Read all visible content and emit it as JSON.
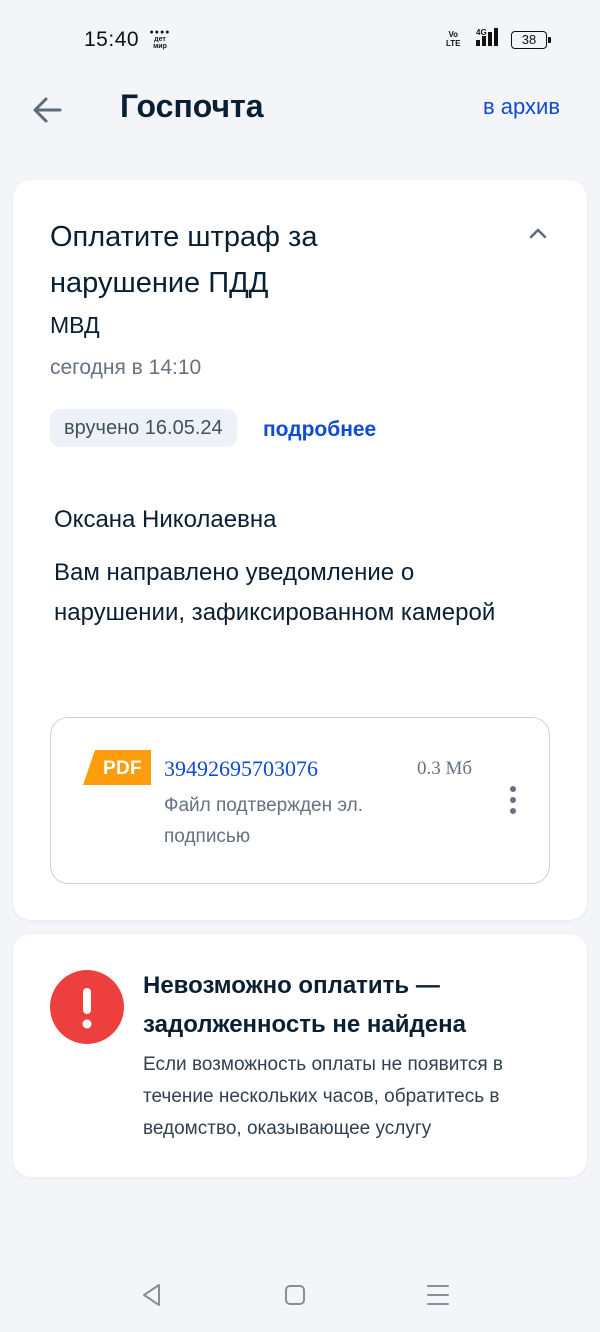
{
  "status_bar": {
    "time": "15:40",
    "app_badge_line1": "дет",
    "app_badge_line2": "мир",
    "volte_line1": "Vo",
    "volte_line2": "LTE",
    "network": "4G",
    "battery": "38"
  },
  "header": {
    "title": "Госпочта",
    "archive_link": "в архив"
  },
  "message": {
    "title": "Оплатите штраф за нарушение ПДД",
    "sender": "МВД",
    "date": "сегодня в 14:10",
    "delivered_badge": "вручено 16.05.24",
    "details_link": "подробнее",
    "recipient": "Оксана Николаевна",
    "text": "Вам направлено уведомление о нарушении, зафиксированном камерой",
    "attachment": {
      "type_label": "PDF",
      "file_name": "39492695703076",
      "file_size": "0.3 Мб",
      "signature_note": "Файл подтвержден эл. подписью"
    }
  },
  "payment_error": {
    "title": "Невозможно оплатить — задолженность не найдена",
    "text": "Если возможность оплаты не появится в течение нескольких часов, обратитесь в ведомство, оказывающее услугу"
  },
  "colors": {
    "accent": "#0d4cd3",
    "pdf_badge": "#ff9e0d",
    "error": "#ee3f3f"
  },
  "icons": {
    "back": "back-arrow-icon",
    "collapse": "chevron-up-icon",
    "file_menu": "more-vertical-icon",
    "error": "exclamation-circle-icon",
    "nav_back": "triangle-back-icon",
    "nav_home": "square-home-icon",
    "nav_menu": "hamburger-menu-icon"
  }
}
